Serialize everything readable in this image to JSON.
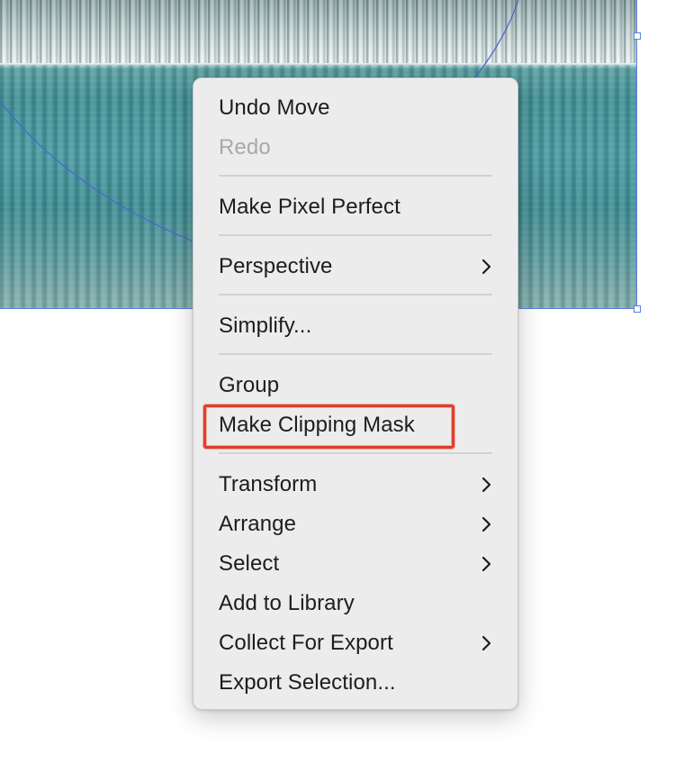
{
  "canvas": {
    "image_name": "frozen-lake-photo",
    "selection_color": "#5b7fe0"
  },
  "menu": {
    "items": [
      {
        "label": "Undo Move",
        "enabled": true,
        "submenu": false
      },
      {
        "label": "Redo",
        "enabled": false,
        "submenu": false
      },
      {
        "label": "Make Pixel Perfect",
        "enabled": true,
        "submenu": false
      },
      {
        "label": "Perspective",
        "enabled": true,
        "submenu": true
      },
      {
        "label": "Simplify...",
        "enabled": true,
        "submenu": false
      },
      {
        "label": "Group",
        "enabled": true,
        "submenu": false
      },
      {
        "label": "Make Clipping Mask",
        "enabled": true,
        "submenu": false,
        "annotated": true
      },
      {
        "label": "Transform",
        "enabled": true,
        "submenu": true
      },
      {
        "label": "Arrange",
        "enabled": true,
        "submenu": true
      },
      {
        "label": "Select",
        "enabled": true,
        "submenu": true
      },
      {
        "label": "Add to Library",
        "enabled": true,
        "submenu": false
      },
      {
        "label": "Collect For Export",
        "enabled": true,
        "submenu": true
      },
      {
        "label": "Export Selection...",
        "enabled": true,
        "submenu": false
      }
    ],
    "submenu_icon": "chevron-right-icon"
  },
  "annotation": {
    "color": "#e03e2a",
    "target": "Make Clipping Mask"
  }
}
